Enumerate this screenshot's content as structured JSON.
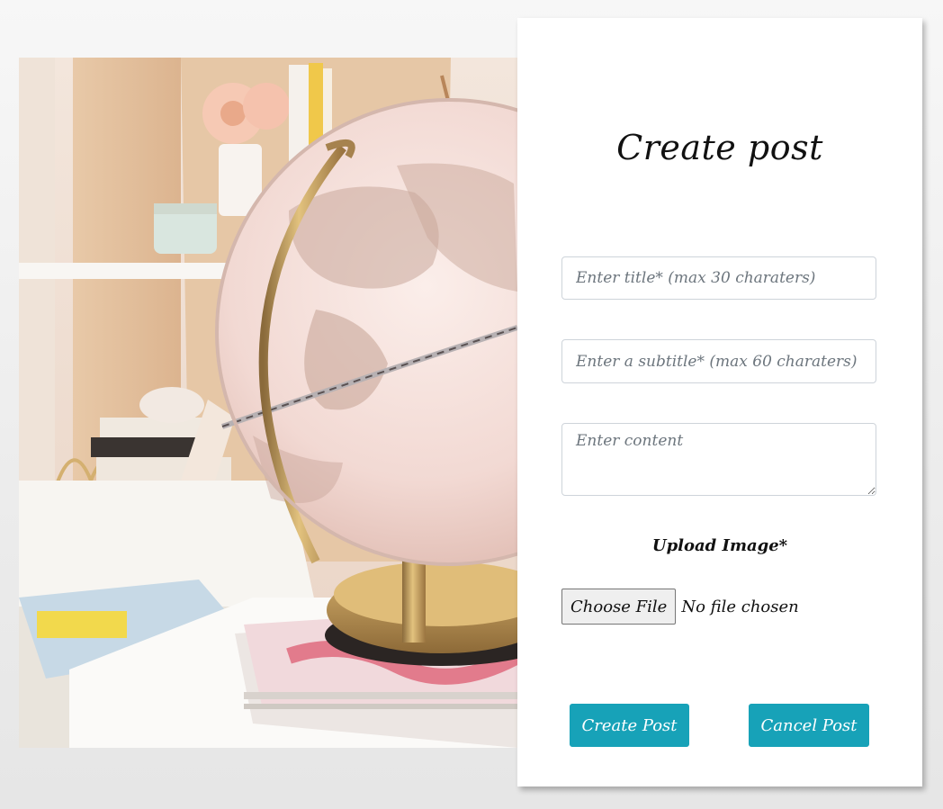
{
  "form": {
    "title": "Create post",
    "title_input": {
      "placeholder": "Enter title* (max 30 charaters)",
      "value": ""
    },
    "subtitle_input": {
      "placeholder": "Enter a subtitle* (max 60 charaters)",
      "value": ""
    },
    "content_input": {
      "placeholder": "Enter content",
      "value": ""
    },
    "upload_label": "Upload Image*",
    "file_button_label": "Choose File",
    "file_status": "No file chosen",
    "create_button_label": "Create Post",
    "cancel_button_label": "Cancel Post"
  },
  "photo": {
    "subject": "pink-world-globe-on-brass-stand"
  },
  "colors": {
    "accent": "#17a2b8",
    "card_background": "#ffffff",
    "page_background": "#ececec",
    "input_border": "#ced4da"
  }
}
